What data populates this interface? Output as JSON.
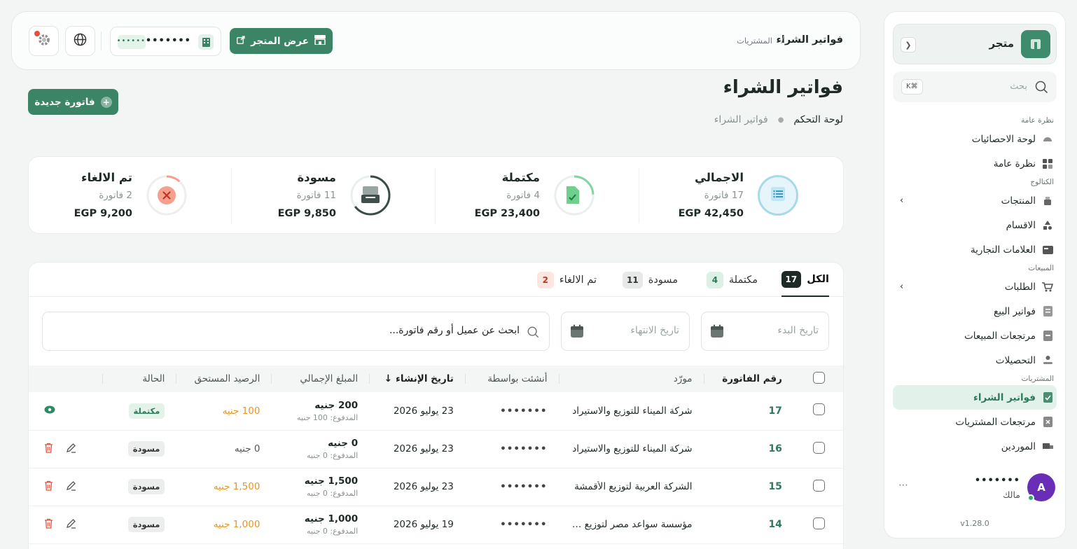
{
  "sidebar": {
    "store_name": "متجر",
    "search_placeholder": "بحث",
    "search_shortcut": "⌘K",
    "sections": {
      "overview": "نظرة عامة",
      "catalog": "الكتالوج",
      "sales": "المبيعات",
      "purchases": "المشتريات"
    },
    "items": {
      "stats_dashboard": "لوحة الاحصائيات",
      "overview": "نظرة عامة",
      "products": "المنتجات",
      "categories": "الاقسام",
      "brands": "العلامات التجارية",
      "orders": "الطلبات",
      "sales_invoices": "فواتير البيع",
      "sales_returns": "مرتجعات المبيعات",
      "collections": "التحصيلات",
      "purchase_invoices": "فواتير الشراء",
      "purchase_returns": "مرتجعات المشتريات",
      "suppliers": "الموردين"
    },
    "user": {
      "avatar_letter": "A",
      "name": "•••••••",
      "role": "مالك"
    },
    "version": "v1.28.0"
  },
  "topbar": {
    "breadcrumb_title": "فواتير الشراء",
    "breadcrumb_separator": "/",
    "breadcrumb_parent": "المشتريات",
    "view_store_label": "عرض المتجر",
    "account_masked": "•••••••••••",
    "account_pill": "••••••"
  },
  "page": {
    "title": "فواتير الشراء",
    "crumb_home": "لوحة التحكم",
    "crumb_current": "فواتير الشراء",
    "new_invoice_label": "فاتورة جديدة"
  },
  "stats": [
    {
      "label": "الاجمالي",
      "count": "17 فاتورة",
      "amount": "EGP 42,450",
      "progress": 1.0
    },
    {
      "label": "مكتملة",
      "count": "4 فاتورة",
      "amount": "EGP 23,400",
      "progress": 0.24
    },
    {
      "label": "مسودة",
      "count": "11 فاتورة",
      "amount": "EGP 9,850",
      "progress": 0.65
    },
    {
      "label": "تم الالغاء",
      "count": "2 فاتورة",
      "amount": "EGP 9,200",
      "progress": 0.12
    }
  ],
  "tabs": [
    {
      "label": "الكل",
      "count": "17"
    },
    {
      "label": "مكتملة",
      "count": "4"
    },
    {
      "label": "مسودة",
      "count": "11"
    },
    {
      "label": "تم الالغاء",
      "count": "2"
    }
  ],
  "filters": {
    "start_date_placeholder": "تاريخ البدء",
    "end_date_placeholder": "تاريخ الانتهاء",
    "search_placeholder": "ابحث عن عميل أو رقم فاتورة..."
  },
  "table": {
    "headers": {
      "invoice_no": "رقم الفاتورة",
      "supplier": "مورّد",
      "created_by": "أنشئت بواسطة",
      "created_at": "تاريخ الإنشاء",
      "total": "المبلغ الإجمالي",
      "due": "الرصيد المستحق",
      "status": "الحالة"
    },
    "rows": [
      {
        "no": "17",
        "supplier": "شركة الميناء للتوزيع والاستيراد",
        "by": "•••••••",
        "date": "23 يوليو 2026",
        "total": "200 جنيه",
        "paid": "المدفوع: 100 جنيه",
        "due": "100 جنيه",
        "status": "مكتملة"
      },
      {
        "no": "16",
        "supplier": "شركة الميناء للتوزيع والاستيراد",
        "by": "•••••••",
        "date": "23 يوليو 2026",
        "total": "0 جنيه",
        "paid": "المدفوع: 0 جنيه",
        "due": "0 جنيه",
        "status": "مسودة"
      },
      {
        "no": "15",
        "supplier": "الشركة العربية لتوزيع الأقمشة",
        "by": "•••••••",
        "date": "23 يوليو 2026",
        "total": "1,500 جنيه",
        "paid": "المدفوع: 0 جنيه",
        "due": "1,500 جنيه",
        "status": "مسودة"
      },
      {
        "no": "14",
        "supplier": "مؤسسة سواعد مصر لتوزيع الخامات",
        "by": "•••••••",
        "date": "19 يوليو 2026",
        "total": "1,000 جنيه",
        "paid": "المدفوع: 0 جنيه",
        "due": "1,000 جنيه",
        "status": "مسودة"
      }
    ]
  },
  "colors": {
    "brand": "#3c8466",
    "accent_green": "#2d7a5c",
    "due_orange": "#e89522",
    "cancel_red": "#e5513f"
  }
}
